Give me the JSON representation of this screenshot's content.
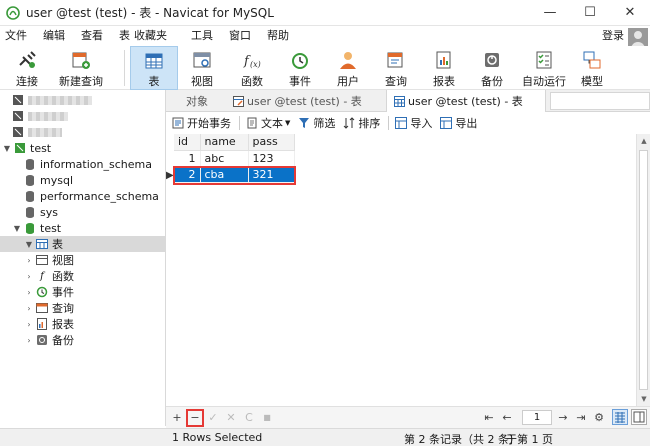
{
  "window": {
    "title": "user @test (test) - 表 - Navicat for MySQL",
    "minimize": "—",
    "maximize": "☐",
    "close": "✕"
  },
  "menu": {
    "items": [
      "文件",
      "编辑",
      "查看",
      "表",
      "收藏夹",
      "工具",
      "窗口",
      "帮助"
    ],
    "login": "登录"
  },
  "toolbar": {
    "buttons": [
      {
        "label": "连接",
        "icon": "connection-icon"
      },
      {
        "label": "新建查询",
        "icon": "new-query-icon"
      },
      {
        "label": "表",
        "icon": "table-icon"
      },
      {
        "label": "视图",
        "icon": "view-icon"
      },
      {
        "label": "函数",
        "icon": "function-icon"
      },
      {
        "label": "事件",
        "icon": "event-icon"
      },
      {
        "label": "用户",
        "icon": "user-icon"
      },
      {
        "label": "查询",
        "icon": "query-icon"
      },
      {
        "label": "报表",
        "icon": "report-icon"
      },
      {
        "label": "备份",
        "icon": "backup-icon"
      },
      {
        "label": "自动运行",
        "icon": "automation-icon"
      },
      {
        "label": "模型",
        "icon": "model-icon"
      }
    ],
    "active": "表"
  },
  "sidebar": {
    "connection": "test",
    "databases": [
      "information_schema",
      "mysql",
      "performance_schema",
      "sys",
      "test"
    ],
    "objects": [
      {
        "label": "表",
        "icon": "table-icon"
      },
      {
        "label": "视图",
        "icon": "view-icon"
      },
      {
        "label": "函数",
        "icon": "function-icon"
      },
      {
        "label": "事件",
        "icon": "event-icon"
      },
      {
        "label": "查询",
        "icon": "query-icon"
      },
      {
        "label": "报表",
        "icon": "report-icon"
      },
      {
        "label": "备份",
        "icon": "backup-icon"
      }
    ]
  },
  "tabs": {
    "objects": "对象",
    "designer": "user @test (test) - 表",
    "data": "user @test (test) - 表"
  },
  "subtoolbar": {
    "begin_transaction": "开始事务",
    "text": "文本",
    "filter": "筛选",
    "sort": "排序",
    "import": "导入",
    "export": "导出"
  },
  "grid": {
    "columns": [
      "id",
      "name",
      "pass"
    ],
    "rows": [
      {
        "id": "1",
        "name": "abc",
        "pass": "123"
      },
      {
        "id": "2",
        "name": "cba",
        "pass": "321"
      }
    ],
    "selected_row": 1
  },
  "bottombar": {
    "add": "+",
    "delete": "−",
    "apply": "✓",
    "discard": "✕",
    "refresh": "C",
    "stop": "■",
    "first": "⇤",
    "prev": "←",
    "page": "1",
    "next": "→",
    "last": "⇥",
    "settings": "⚙"
  },
  "status": {
    "left": "1 Rows Selected",
    "record": "第 2 条记录（共 2 条）",
    "page": "于第 1 页"
  },
  "colors": {
    "selection": "#0a72c8",
    "highlight_box": "#e53935",
    "toolbar_active": "#cde4f7"
  }
}
